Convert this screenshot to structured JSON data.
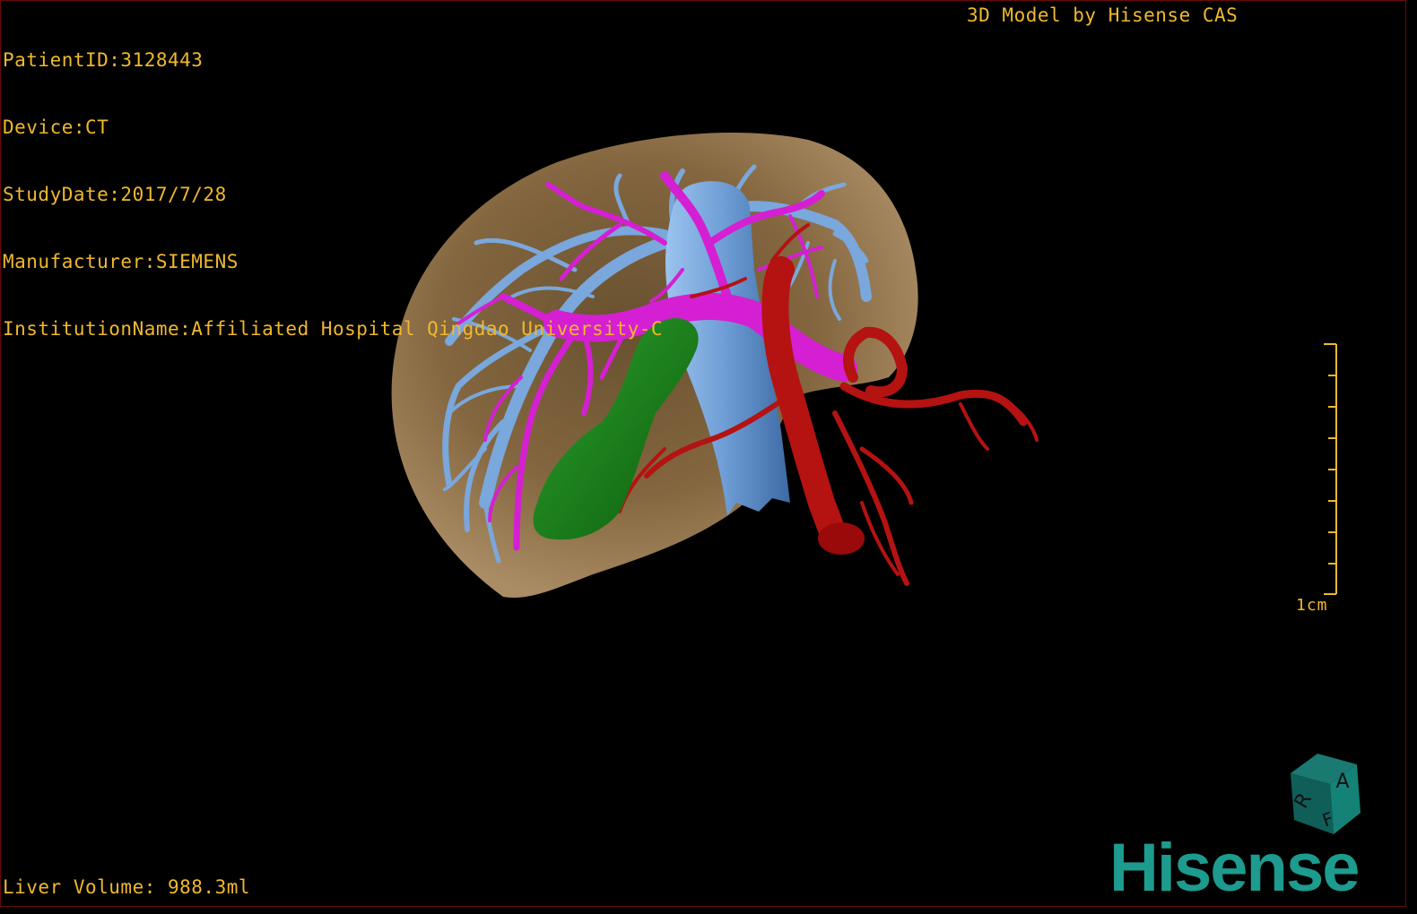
{
  "header": {
    "patient_id": "PatientID:3128443",
    "device": "Device:CT",
    "study_date": "StudyDate:2017/7/28",
    "manufacturer": "Manufacturer:SIEMENS",
    "institution": "InstitutionName:Affiliated Hospital Qingdao University-C",
    "credit": "3D Model by Hisense CAS"
  },
  "footer": {
    "volume": "Liver Volume: 988.3ml"
  },
  "scale": {
    "label": "1cm"
  },
  "orientation_cube": {
    "labels": [
      "A",
      "R",
      "F"
    ]
  },
  "brand": {
    "logo": "Hisense"
  },
  "colors": {
    "text": "#f0b82e",
    "liver": "#9a7a4e",
    "hepatic_vein": "#6f9fd8",
    "portal_vein": "#d31ed0",
    "artery": "#b01010",
    "gallbladder": "#1b8a1b",
    "brand": "#1c9b8e"
  }
}
